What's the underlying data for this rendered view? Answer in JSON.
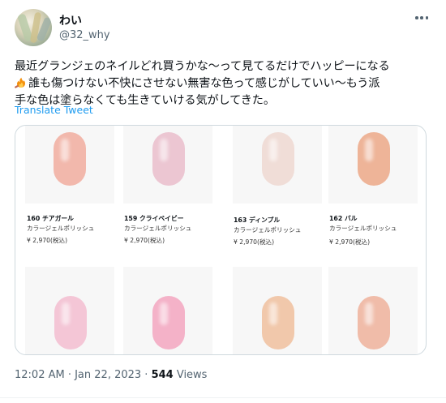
{
  "author": {
    "name": "わい",
    "handle": "@32_why"
  },
  "tweet": {
    "line1": "最近グランジェのネイルどれ買うかな〜って見てるだけでハッピーになる",
    "line2": "誰も傷つけない不快にさせない無害な色って感じがしていい〜もう派",
    "line3": "手な色は塗らなくても生きていける気がしてきた。",
    "emoji": "fire-icon"
  },
  "translate_label": "Translate Tweet",
  "products": [
    {
      "name": "160 チアガール",
      "type": "カラージェルポリッシュ",
      "price": "¥ 2,970(税込)",
      "color": "#f2b8ac"
    },
    {
      "name": "159 クライベイビー",
      "type": "カラージェルポリッシュ",
      "price": "¥ 2,970(税込)",
      "color": "#ecc6d2"
    },
    {
      "name": "163 ディンプル",
      "type": "カラージェルポリッシュ",
      "price": "¥ 2,970(税込)",
      "color": "#f0ddd7"
    },
    {
      "name": "162 バル",
      "type": "カラージェルポリッシュ",
      "price": "¥ 2,970(税込)",
      "color": "#eeb498"
    },
    {
      "color": "#f4c6d6"
    },
    {
      "color": "#f4b2c8"
    },
    {
      "color": "#f1c8ab"
    },
    {
      "color": "#f0bca9"
    }
  ],
  "meta": {
    "time": "12:02 AM · Jan 22, 2023 · ",
    "views_count": "544",
    "views_label": " Views"
  },
  "colors": {
    "link": "#1d9bf0",
    "secondary_text": "#536471",
    "border": "#cfd9de"
  }
}
